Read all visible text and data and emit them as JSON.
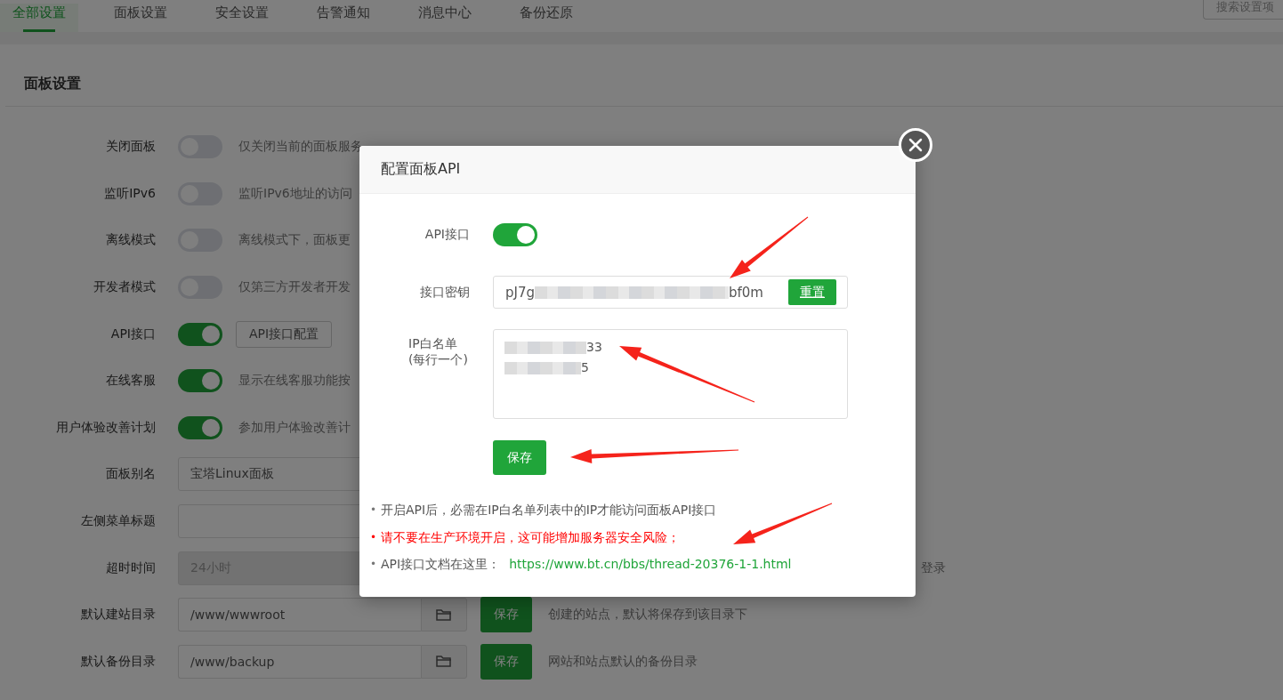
{
  "tabs": [
    {
      "label": "全部设置",
      "selected": true
    },
    {
      "label": "面板设置",
      "selected": false
    },
    {
      "label": "安全设置",
      "selected": false
    },
    {
      "label": "告警通知",
      "selected": false
    },
    {
      "label": "消息中心",
      "selected": false
    },
    {
      "label": "备份还原",
      "selected": false
    }
  ],
  "search": {
    "placeholder": "搜索设置项"
  },
  "section_title": "面板设置",
  "rows": [
    {
      "kind": "toggle",
      "label": "关闭面板",
      "on": false,
      "desc": "仅关闭当前的面板服务"
    },
    {
      "kind": "toggle",
      "label": "监听IPv6",
      "on": false,
      "desc": "监听IPv6地址的访问"
    },
    {
      "kind": "toggle",
      "label": "离线模式",
      "on": false,
      "desc": "离线模式下，面板更"
    },
    {
      "kind": "toggle",
      "label": "开发者模式",
      "on": false,
      "desc": "仅第三方开发者开发"
    },
    {
      "kind": "toggle_button",
      "label": "API接口",
      "on": true,
      "button": "API接口配置"
    },
    {
      "kind": "toggle",
      "label": "在线客服",
      "on": true,
      "desc": "显示在线客服功能按"
    },
    {
      "kind": "toggle",
      "label": "用户体验改善计划",
      "on": true,
      "desc": "参加用户体验改善计"
    },
    {
      "kind": "text",
      "label": "面板别名",
      "value": "宝塔Linux面板"
    },
    {
      "kind": "text",
      "label": "左侧菜单标题"
    },
    {
      "kind": "text",
      "label": "超时时间",
      "value": "24小时",
      "disabled": true,
      "desc_tail": "登录"
    },
    {
      "kind": "path",
      "label": "默认建站目录",
      "value": "/www/wwwroot",
      "button": "保存",
      "desc": "创建的站点，默认将保存到该目录下"
    },
    {
      "kind": "path",
      "label": "默认备份目录",
      "value": "/www/backup",
      "button": "保存",
      "desc": "网站和站点默认的备份目录"
    }
  ],
  "modal": {
    "title": "配置面板API",
    "api_label": "API接口",
    "api_on": true,
    "key_label": "接口密钥",
    "key_start": "pJ7g",
    "key_end": "bf0m",
    "reset_button": "重置",
    "whitelist_label": "IP白名单",
    "whitelist_hint": "(每行一个)",
    "whitelist_lines": [
      {
        "end": "33"
      },
      {
        "end": "5"
      }
    ],
    "save_button": "保存",
    "notes": [
      {
        "kind": "plain",
        "bullet": "•",
        "text": "开启API后，必需在IP白名单列表中的IP才能访问面板API接口"
      },
      {
        "kind": "warning",
        "bullet": "•",
        "text": "请不要在生产环境开启，这可能增加服务器安全风险；"
      },
      {
        "kind": "link",
        "bullet": "•",
        "text": "API接口文档在这里：",
        "link": "https://www.bt.cn/bbs/thread-20376-1-1.html"
      }
    ]
  }
}
